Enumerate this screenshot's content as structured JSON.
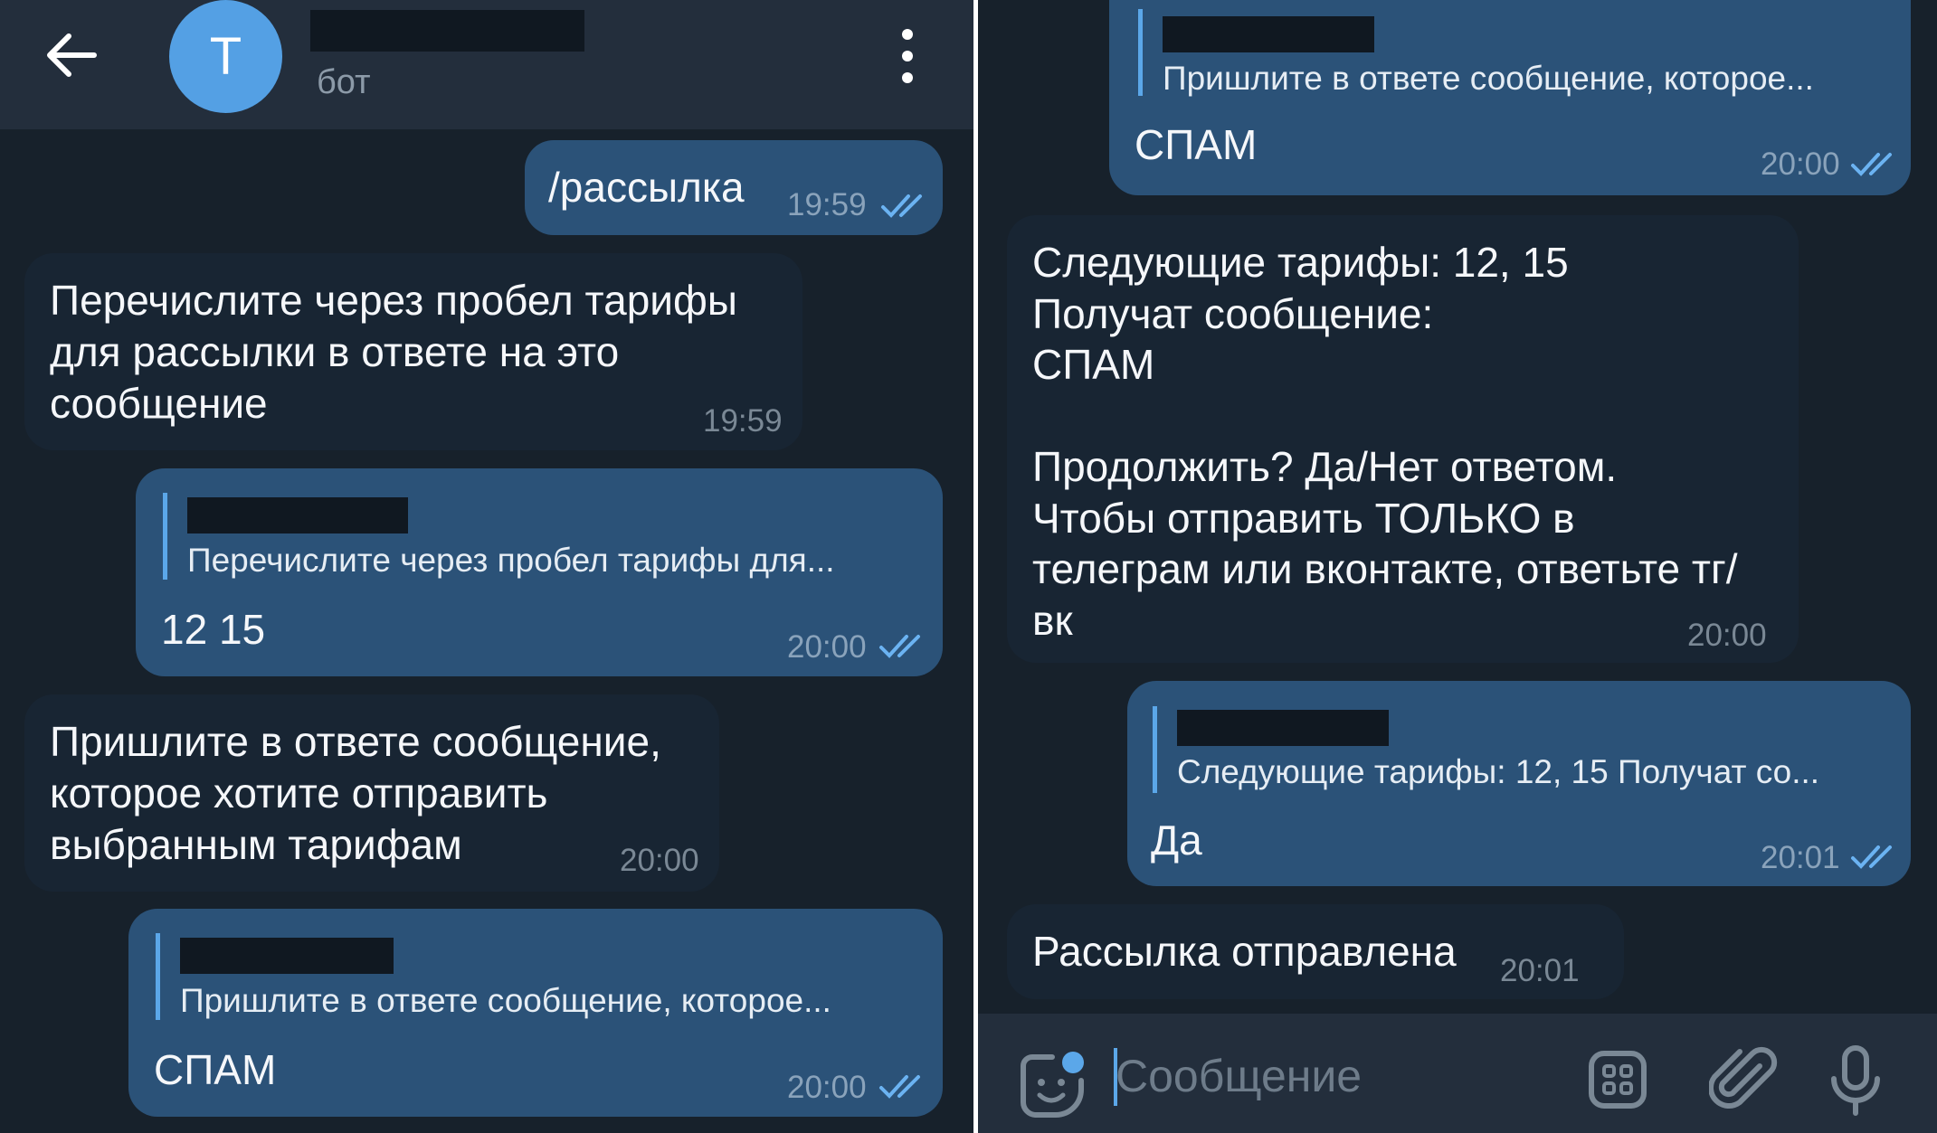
{
  "chat": {
    "subtitle": "бот",
    "avatar_letter": "Т"
  },
  "left_messages": [
    {
      "text": "/рассылка",
      "time": "19:59"
    },
    {
      "text": "Перечислите через пробел тарифы\nдля рассылки в ответе на это\nсообщение",
      "time": "19:59"
    },
    {
      "quote": "Перечислите через пробел тарифы для...",
      "text": "12 15",
      "time": "20:00"
    },
    {
      "text": "Пришлите в ответе сообщение,\nкоторое хотите отправить\nвыбранным тарифам",
      "time": "20:00"
    },
    {
      "quote": "Пришлите в ответе сообщение, которое...",
      "text": "СПАМ",
      "time": "20:00"
    }
  ],
  "right_messages": [
    {
      "quote": "Пришлите в ответе сообщение, которое...",
      "text": "СПАМ",
      "time": "20:00"
    },
    {
      "text": "Следующие тарифы: 12, 15\nПолучат сообщение:\nСПАМ\n\nПродолжить? Да/Нет ответом.\nЧтобы отправить ТОЛЬКО в\nтелеграм или вконтакте, ответьте тг/\nвк",
      "time": "20:00"
    },
    {
      "quote": "Следующие тарифы: 12, 15 Получат со...",
      "text": "Да",
      "time": "20:01"
    },
    {
      "text": "Рассылка отправлена",
      "time": "20:01"
    }
  ],
  "composer": {
    "placeholder": "Сообщение"
  },
  "colors": {
    "outgoing": "#2b5278",
    "incoming": "#182533",
    "background": "#17212b",
    "accent": "#5ba7e9"
  },
  "icons": [
    "back-arrow-icon",
    "more-vertical-icon",
    "double-check-icon",
    "sticker-icon",
    "bot-commands-icon",
    "attach-icon",
    "mic-icon"
  ]
}
